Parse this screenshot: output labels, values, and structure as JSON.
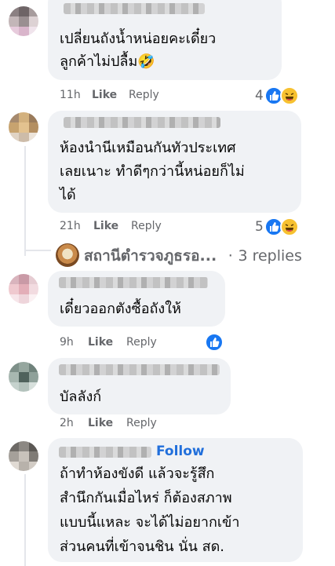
{
  "comments": [
    {
      "text_lines": [
        "เปลี่ยนถังน้ำหน่อยคะเดี๋ยว",
        "ลูกค้าไม่ปลื้ม🤣"
      ],
      "time": "11h",
      "like_label": "Like",
      "reply_label": "Reply",
      "reaction_count": "4"
    },
    {
      "text_lines": [
        "ห้องนำนีเหมือนกันทัวประเทศ",
        "เลยเนาะ ทำดีๆกว่านี้หน่อยก็ไม่",
        "ได้"
      ],
      "time": "21h",
      "like_label": "Like",
      "reply_label": "Reply",
      "reaction_count": "5"
    },
    {
      "text_lines": [
        "เดี๋ยวออกตังซื้อถังให้"
      ],
      "time": "9h",
      "like_label": "Like",
      "reply_label": "Reply"
    },
    {
      "text_lines": [
        "บัลลังก์"
      ],
      "time": "2h",
      "like_label": "Like",
      "reply_label": "Reply"
    },
    {
      "follow_label": "Follow",
      "text_lines": [
        "ถ้าทำห้องขังดี แล้วจะรู้สึก",
        "สำนึกกันเมื่อไหร่ ก็ต้องสภาพ",
        "แบบนี้แหละ จะได้ไม่อยากเข้า",
        "ส่วนคนที่เข้าจนชิน นั่น สด."
      ]
    }
  ],
  "reply_thread": {
    "page_name": "สถานีตำรวจภูธรอ...",
    "separator": "·",
    "replies_label": "3 replies"
  },
  "colors": {
    "bubble": "#f0f2f5",
    "meta_text": "#65676b",
    "like_blue": "#1877f2",
    "follow_blue": "#216fdb"
  }
}
